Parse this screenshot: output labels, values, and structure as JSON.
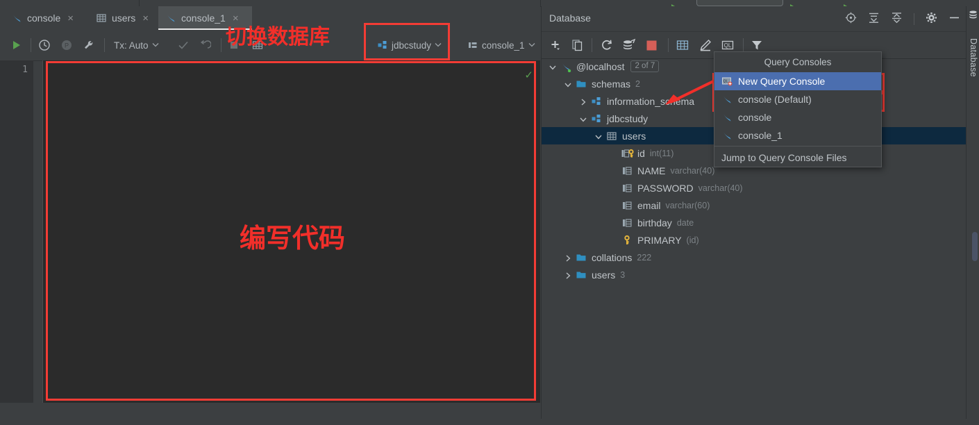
{
  "app": {
    "editor_bg": "#2b2b2b",
    "panel_bg": "#3c3f41",
    "accent_selection": "#4b6eaf",
    "tree_selection": "#0d293f",
    "annotation_color": "#f22f2a"
  },
  "editor": {
    "tabs": [
      {
        "label": "console",
        "icon": "query-console-icon",
        "active": false,
        "closable": true
      },
      {
        "label": "users",
        "icon": "table-icon",
        "active": false,
        "closable": true
      },
      {
        "label": "console_1",
        "icon": "query-console-icon",
        "active": true,
        "closable": true
      }
    ],
    "close_glyph": "×",
    "toolbar": {
      "run_label": "run-button",
      "history_label": "history-button",
      "pending_label": "pending-button",
      "settings_label": "data-source-properties-button",
      "tx_label": "Tx: Auto",
      "commit_label": "commit-button",
      "rollback_label": "rollback-button",
      "stop_label": "stop-button",
      "schema_select": "jdbcstudy",
      "console_select": "console_1",
      "caret_glyph": "⌄"
    },
    "line_numbers": [
      "1"
    ],
    "content_text": "编写代码",
    "inspection_ok_glyph": "✓"
  },
  "annotations": [
    {
      "name": "switch-database-label",
      "text": "切换数据库"
    },
    {
      "name": "write-code-label",
      "text": "编写代码"
    }
  ],
  "database_panel": {
    "title": "Database",
    "header_icons": [
      "locate-icon",
      "expand-all-icon",
      "collapse-all-icon",
      "settings-gear-icon",
      "hide-icon"
    ],
    "toolbar_icons": [
      "add-icon",
      "duplicate-icon",
      "refresh-icon",
      "sync-icon",
      "stop-icon",
      "table-editor-icon",
      "modify-icon",
      "query-console-icon",
      "filter-icon"
    ],
    "tree": [
      {
        "name": "@localhost",
        "icon": "datasource-icon",
        "meta": "",
        "badge": "2 of 7",
        "indent": 0,
        "expanded": true,
        "selected": false
      },
      {
        "name": "schemas",
        "icon": "folder-icon",
        "meta": "2",
        "badge": "",
        "indent": 1,
        "expanded": true,
        "selected": false
      },
      {
        "name": "information_schema",
        "icon": "schema-icon",
        "meta": "",
        "badge": "",
        "indent": 2,
        "expanded": false,
        "selected": false
      },
      {
        "name": "jdbcstudy",
        "icon": "schema-icon",
        "meta": "",
        "badge": "",
        "indent": 2,
        "expanded": true,
        "selected": false
      },
      {
        "name": "users",
        "icon": "table-icon",
        "meta": "",
        "badge": "",
        "indent": 3,
        "expanded": true,
        "selected": true
      },
      {
        "name": "id",
        "icon": "primary-column-icon",
        "meta": "int(11)",
        "badge": "",
        "indent": 4,
        "expanded": null,
        "selected": false
      },
      {
        "name": "NAME",
        "icon": "column-icon",
        "meta": "varchar(40)",
        "badge": "",
        "indent": 4,
        "expanded": null,
        "selected": false
      },
      {
        "name": "PASSWORD",
        "icon": "column-icon",
        "meta": "varchar(40)",
        "badge": "",
        "indent": 4,
        "expanded": null,
        "selected": false
      },
      {
        "name": "email",
        "icon": "column-icon",
        "meta": "varchar(60)",
        "badge": "",
        "indent": 4,
        "expanded": null,
        "selected": false
      },
      {
        "name": "birthday",
        "icon": "column-icon",
        "meta": "date",
        "badge": "",
        "indent": 4,
        "expanded": null,
        "selected": false
      },
      {
        "name": "PRIMARY",
        "icon": "key-icon",
        "meta": "(id)",
        "badge": "",
        "indent": 4,
        "expanded": null,
        "selected": false
      },
      {
        "name": "collations",
        "icon": "folder-icon",
        "meta": "222",
        "badge": "",
        "indent": 1,
        "expanded": false,
        "selected": false
      },
      {
        "name": "users",
        "icon": "folder-icon",
        "meta": "3",
        "badge": "",
        "indent": 1,
        "expanded": false,
        "selected": false
      }
    ]
  },
  "query_consoles_popup": {
    "title": "Query Consoles",
    "items": [
      {
        "label": "New Query Console",
        "icon": "new-query-console-icon",
        "highlighted": true
      },
      {
        "label": "console (Default)",
        "icon": "query-console-icon",
        "highlighted": false
      },
      {
        "label": "console",
        "icon": "query-console-icon",
        "highlighted": false
      },
      {
        "label": "console_1",
        "icon": "query-console-icon",
        "highlighted": false
      }
    ],
    "footer": "Jump to Query Console Files"
  },
  "right_edge": {
    "label": "Database",
    "icon": "database-icon"
  }
}
